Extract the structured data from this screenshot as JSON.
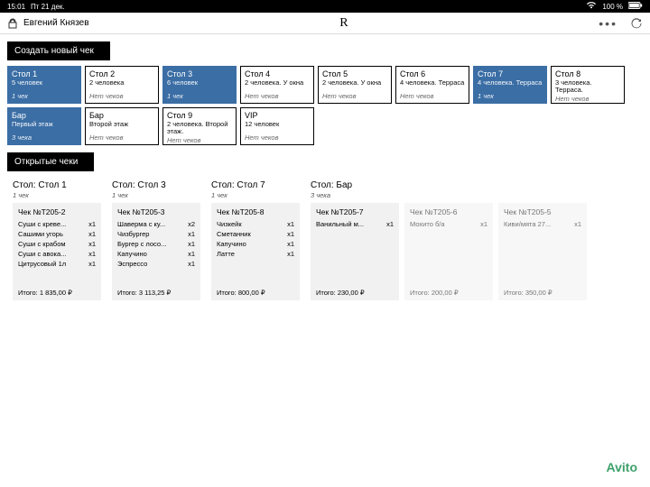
{
  "status": {
    "time": "15:01",
    "date": "Пт 21 дек.",
    "wifi": "wifi-icon",
    "battery_text": "100 %",
    "battery_icon": "battery-icon"
  },
  "topbar": {
    "user": "Евгений Князев",
    "logo": "R"
  },
  "section_new_label": "Создать новый чек",
  "tables": [
    {
      "name": "Стол 1",
      "desc": "5 человек",
      "sub": "1 чек",
      "selected": true
    },
    {
      "name": "Стол 2",
      "desc": "2 человека",
      "sub": "Нет чеков",
      "selected": false
    },
    {
      "name": "Стол 3",
      "desc": "6 человек",
      "sub": "1 чек",
      "selected": true
    },
    {
      "name": "Стол 4",
      "desc": "2 человека. У окна",
      "sub": "Нет чеков",
      "selected": false
    },
    {
      "name": "Стол 5",
      "desc": "2 человека. У окна",
      "sub": "Нет чеков",
      "selected": false
    },
    {
      "name": "Стол 6",
      "desc": "4 человека. Терраса",
      "sub": "Нет чеков",
      "selected": false
    },
    {
      "name": "Стол 7",
      "desc": "4 человека. Терраса",
      "sub": "1 чек",
      "selected": true
    },
    {
      "name": "Стол 8",
      "desc": "3 человека. Терраса.",
      "sub": "Нет чеков",
      "selected": false
    },
    {
      "name": "Бар",
      "desc": "Первый этаж",
      "sub": "3 чека",
      "selected": true
    },
    {
      "name": "Бар",
      "desc": "Второй этаж",
      "sub": "Нет чеков",
      "selected": false
    },
    {
      "name": "Стол 9",
      "desc": "2 человека. Второй этаж.",
      "sub": "Нет чеков",
      "selected": false
    },
    {
      "name": "VIP",
      "desc": "12 человек",
      "sub": "Нет чеков",
      "selected": false
    }
  ],
  "section_open_label": "Открытые чеки",
  "check_groups": [
    {
      "title": "Стол: Стол 1",
      "sub": "1 чек",
      "checks": [
        {
          "title": "Чек №T205-2",
          "faded": false,
          "items": [
            {
              "name": "Суши с креве...",
              "qty": "x1"
            },
            {
              "name": "Сашими угорь",
              "qty": "x1"
            },
            {
              "name": "Суши с крабом",
              "qty": "x1"
            },
            {
              "name": "Суши с авока...",
              "qty": "x1"
            },
            {
              "name": "Цитрусовый 1л",
              "qty": "x1"
            }
          ],
          "total": "Итого: 1 835,00 ₽"
        }
      ]
    },
    {
      "title": "Стол: Стол 3",
      "sub": "1 чек",
      "checks": [
        {
          "title": "Чек №T205-3",
          "faded": false,
          "items": [
            {
              "name": "Шаверма с ку...",
              "qty": "x2"
            },
            {
              "name": "Чизбургер",
              "qty": "x1"
            },
            {
              "name": "Бургер с лосо...",
              "qty": "x1"
            },
            {
              "name": "Капучино",
              "qty": "x1"
            },
            {
              "name": "Эспрессо",
              "qty": "x1"
            }
          ],
          "total": "Итого: 3 113,25 ₽"
        }
      ]
    },
    {
      "title": "Стол: Стол 7",
      "sub": "1 чек",
      "checks": [
        {
          "title": "Чек №T205-8",
          "faded": false,
          "items": [
            {
              "name": "Чизкейк",
              "qty": "x1"
            },
            {
              "name": "Сметанник",
              "qty": "x1"
            },
            {
              "name": "Капучино",
              "qty": "x1"
            },
            {
              "name": "Латте",
              "qty": "x1"
            }
          ],
          "total": "Итого: 800,00 ₽"
        }
      ]
    },
    {
      "title": "Стол: Бар",
      "sub": "3 чека",
      "checks": [
        {
          "title": "Чек №T205-7",
          "faded": false,
          "items": [
            {
              "name": "Ванильный м...",
              "qty": "x1"
            }
          ],
          "total": "Итого: 230,00 ₽"
        },
        {
          "title": "Чек №T205-6",
          "faded": true,
          "items": [
            {
              "name": "Мохито б/а",
              "qty": "x1"
            }
          ],
          "total": "Итого: 200,00 ₽"
        },
        {
          "title": "Чек №T205-5",
          "faded": true,
          "items": [
            {
              "name": "Киви/мята 27...",
              "qty": "x1"
            }
          ],
          "total": "Итого: 350,00 ₽"
        }
      ]
    }
  ],
  "watermark": "Avito"
}
